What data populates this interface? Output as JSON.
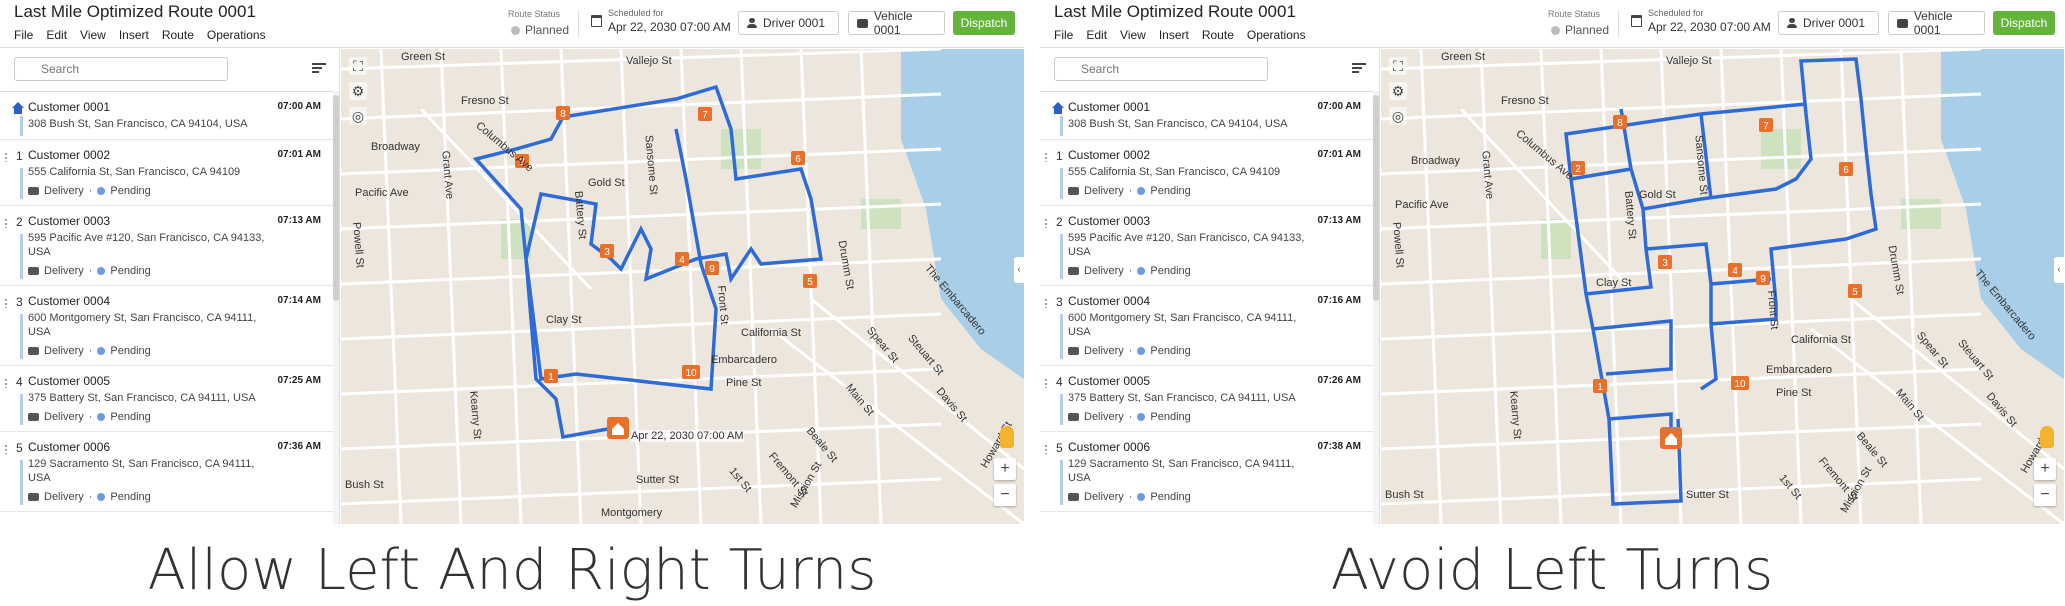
{
  "header": {
    "app_title": "Last Mile Optimized Route 0001",
    "menu": [
      "File",
      "Edit",
      "View",
      "Insert",
      "Route",
      "Operations"
    ],
    "route_status_label": "Route Status",
    "route_status_value": "Planned",
    "scheduled_label": "Scheduled for",
    "scheduled_value": "Apr 22, 2030 07:00 AM",
    "driver": "Driver 0001",
    "vehicle": "Vehicle 0001",
    "dispatch_label": "Dispatch"
  },
  "search": {
    "placeholder": "Search"
  },
  "colors": {
    "route": "#2f6bd6",
    "marker": "#e8702a",
    "dispatch": "#64b33a",
    "pending": "#6f9bd9",
    "water": "#a9cfe8",
    "park": "#cfe2bf"
  },
  "panels": [
    {
      "caption": "Allow Left And Right Turns",
      "stops": [
        {
          "num": "",
          "name": "Customer 0001",
          "address": "308 Bush St, San Francisco, CA 94104, USA",
          "time": "07:00 AM",
          "type": "",
          "status": ""
        },
        {
          "num": "1",
          "name": "Customer 0002",
          "address": "555 California St, San Francisco, CA 94109",
          "time": "07:01 AM",
          "type": "Delivery",
          "status": "Pending"
        },
        {
          "num": "2",
          "name": "Customer 0003",
          "address": "595 Pacific Ave #120, San Francisco, CA 94133, USA",
          "time": "07:13 AM",
          "type": "Delivery",
          "status": "Pending"
        },
        {
          "num": "3",
          "name": "Customer 0004",
          "address": "600 Montgomery St, San Francisco, CA 94111, USA",
          "time": "07:14 AM",
          "type": "Delivery",
          "status": "Pending"
        },
        {
          "num": "4",
          "name": "Customer 0005",
          "address": "375 Battery St, San Francisco, CA 94111, USA",
          "time": "07:25 AM",
          "type": "Delivery",
          "status": "Pending"
        },
        {
          "num": "5",
          "name": "Customer 0006",
          "address": "129 Sacramento St, San Francisco, CA 94111, USA",
          "time": "07:36 AM",
          "type": "Delivery",
          "status": "Pending"
        }
      ],
      "map_tooltip": "Apr 22, 2030 07:00 AM",
      "map_labels": [
        "Green St",
        "Vallejo St",
        "Fresno St",
        "Broadway",
        "Columbus Ave",
        "Grant Ave",
        "Pacific Ave",
        "Gold St",
        "Clay St",
        "Sansome St",
        "Battery St",
        "Front St",
        "California St",
        "Embarcadero",
        "Pine St",
        "Bush St",
        "Sutter St",
        "Montgomery",
        "Powell St",
        "Kearny St",
        "Main St",
        "Beale St",
        "Fremont St",
        "1st St",
        "Mission St",
        "Spear St",
        "Steuart St",
        "The Embarcadero",
        "Drumm St",
        "Davis St",
        "Howard St"
      ]
    },
    {
      "caption": "Avoid Left Turns",
      "stops": [
        {
          "num": "",
          "name": "Customer 0001",
          "address": "308 Bush St, San Francisco, CA 94104, USA",
          "time": "07:00 AM",
          "type": "",
          "status": ""
        },
        {
          "num": "1",
          "name": "Customer 0002",
          "address": "555 California St, San Francisco, CA 94109",
          "time": "07:01 AM",
          "type": "Delivery",
          "status": "Pending"
        },
        {
          "num": "2",
          "name": "Customer 0003",
          "address": "595 Pacific Ave #120, San Francisco, CA 94133, USA",
          "time": "07:13 AM",
          "type": "Delivery",
          "status": "Pending"
        },
        {
          "num": "3",
          "name": "Customer 0004",
          "address": "600 Montgomery St, San Francisco, CA 94111, USA",
          "time": "07:16 AM",
          "type": "Delivery",
          "status": "Pending"
        },
        {
          "num": "4",
          "name": "Customer 0005",
          "address": "375 Battery St, San Francisco, CA 94111, USA",
          "time": "07:26 AM",
          "type": "Delivery",
          "status": "Pending"
        },
        {
          "num": "5",
          "name": "Customer 0006",
          "address": "129 Sacramento St, San Francisco, CA 94111, USA",
          "time": "07:38 AM",
          "type": "Delivery",
          "status": "Pending"
        }
      ],
      "map_tooltip": "",
      "map_labels": [
        "Green St",
        "Vallejo St",
        "Fresno St",
        "Broadway",
        "Columbus Ave",
        "Grant Ave",
        "Pacific Ave",
        "Gold St",
        "Clay St",
        "Sansome St",
        "Battery St",
        "Front St",
        "California St",
        "Embarcadero",
        "Pine St",
        "Bush St",
        "Sutter St",
        "Powell St",
        "Kearny St",
        "Main St",
        "Beale St",
        "Fremont St",
        "1st St",
        "Mission St",
        "Spear St",
        "Steuart St",
        "The Embarcadero",
        "Drumm St",
        "Davis St",
        "Howard St"
      ]
    }
  ],
  "markers": [
    "1",
    "2",
    "3",
    "4",
    "5",
    "6",
    "7",
    "8",
    "9",
    "10"
  ]
}
